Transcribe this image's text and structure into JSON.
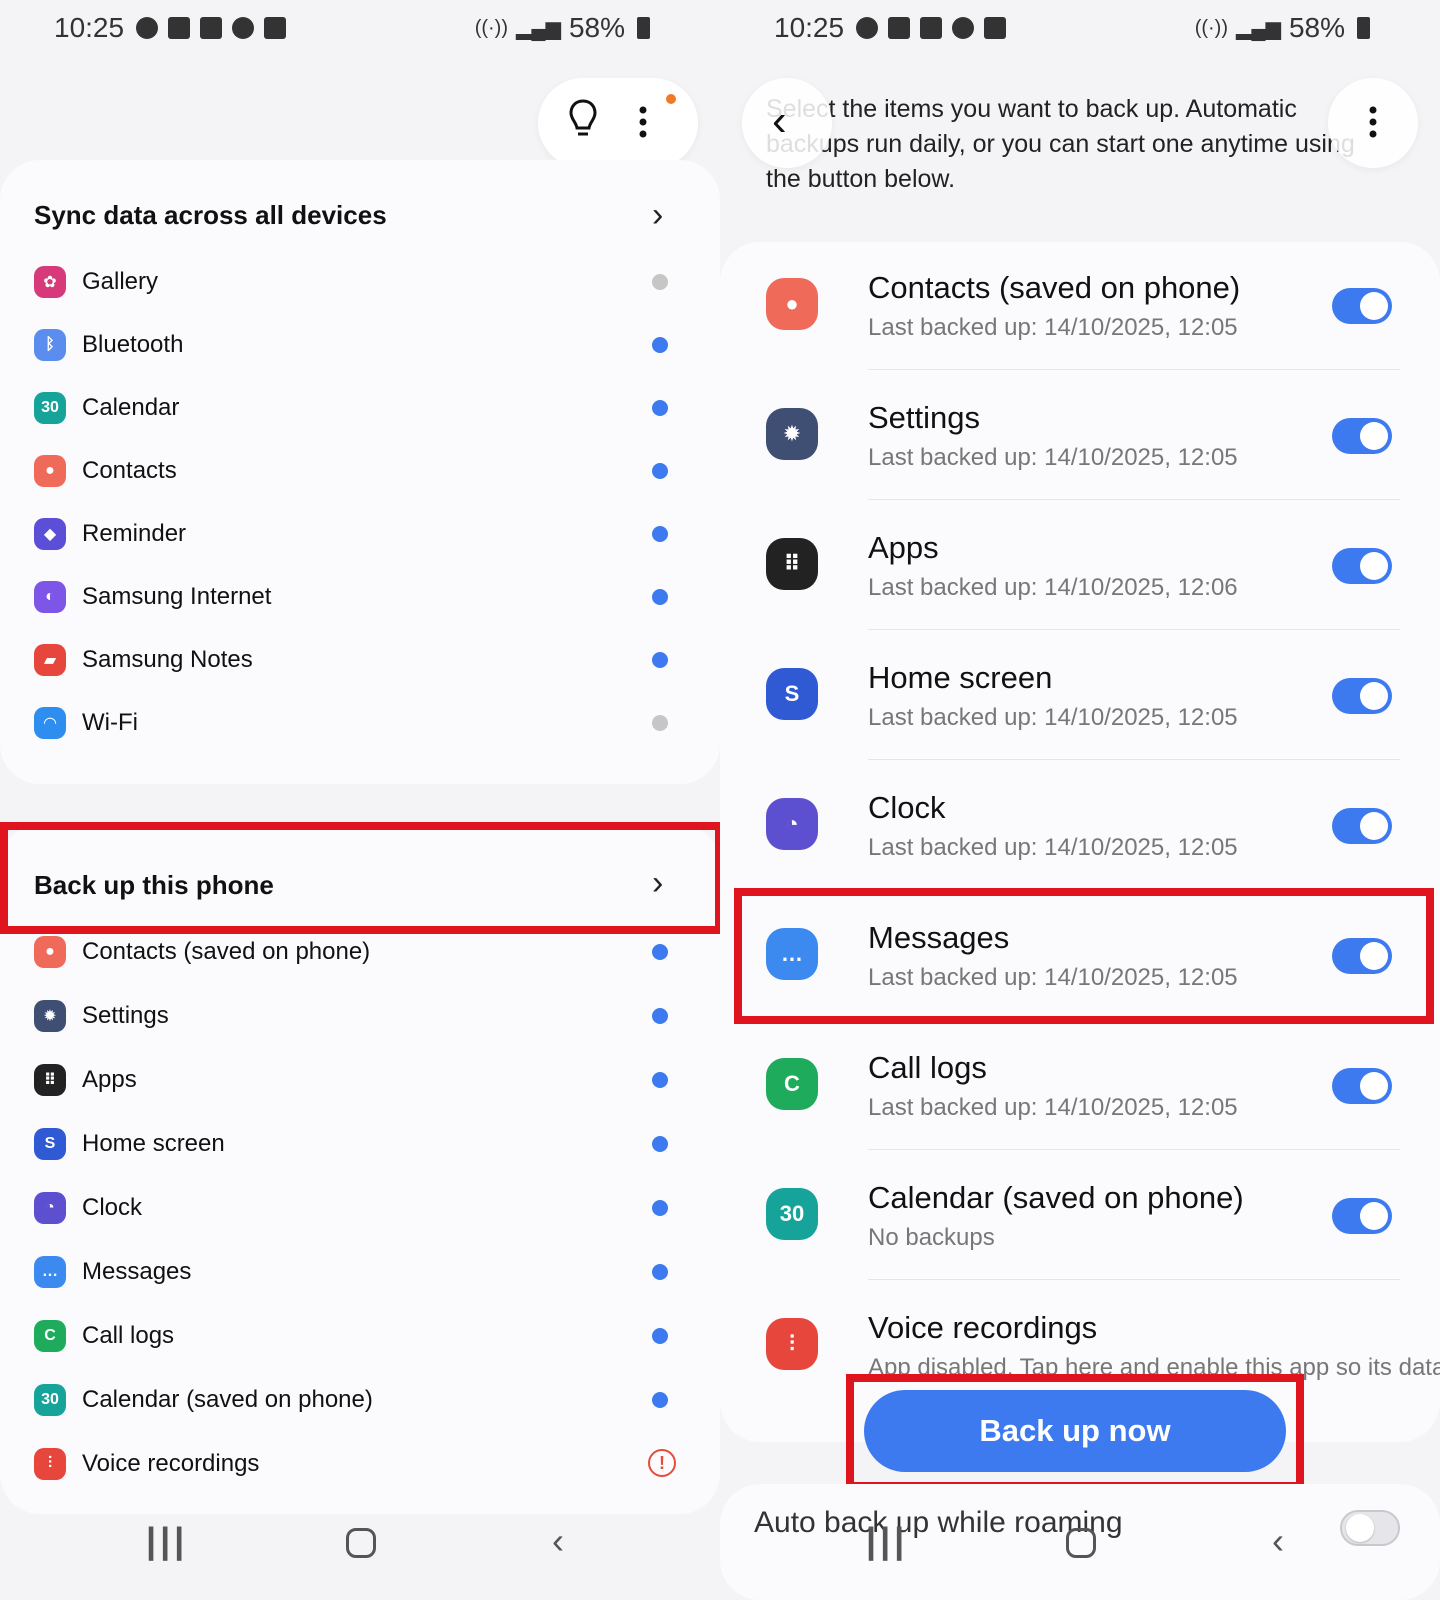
{
  "status_bar": {
    "time": "10:25",
    "battery": "58%"
  },
  "left": {
    "sync_title": "Sync data across all devices",
    "sync_items": [
      {
        "label": "Gallery",
        "icon": "gallery-icon",
        "color": "#d63a7a",
        "state": "off"
      },
      {
        "label": "Bluetooth",
        "icon": "bluetooth-icon",
        "color": "#5b8def",
        "state": "on"
      },
      {
        "label": "Calendar",
        "icon": "calendar-icon",
        "color": "#16a39a",
        "state": "on"
      },
      {
        "label": "Contacts",
        "icon": "contacts-icon",
        "color": "#f06a5a",
        "state": "on"
      },
      {
        "label": "Reminder",
        "icon": "reminder-icon",
        "color": "#5a4fd6",
        "state": "on"
      },
      {
        "label": "Samsung Internet",
        "icon": "internet-icon",
        "color": "#7d56e8",
        "state": "on"
      },
      {
        "label": "Samsung Notes",
        "icon": "notes-icon",
        "color": "#e6463b",
        "state": "on"
      },
      {
        "label": "Wi-Fi",
        "icon": "wifi-icon",
        "color": "#2d8ef0",
        "state": "off"
      }
    ],
    "backup_title": "Back up this phone",
    "backup_items": [
      {
        "label": "Contacts (saved on phone)",
        "icon": "contacts-icon",
        "color": "#f06a5a",
        "state": "on"
      },
      {
        "label": "Settings",
        "icon": "settings-icon",
        "color": "#3f4e73",
        "state": "on"
      },
      {
        "label": "Apps",
        "icon": "apps-icon",
        "color": "#222",
        "state": "on"
      },
      {
        "label": "Home screen",
        "icon": "home-screen-icon",
        "color": "#2f5ad3",
        "state": "on"
      },
      {
        "label": "Clock",
        "icon": "clock-icon",
        "color": "#5c4fd0",
        "state": "on"
      },
      {
        "label": "Messages",
        "icon": "messages-icon",
        "color": "#3c8af0",
        "state": "on"
      },
      {
        "label": "Call logs",
        "icon": "call-logs-icon",
        "color": "#1eab5b",
        "state": "on"
      },
      {
        "label": "Calendar (saved on phone)",
        "icon": "calendar-icon",
        "color": "#16a39a",
        "state": "on"
      },
      {
        "label": "Voice recordings",
        "icon": "voice-recordings-icon",
        "color": "#e6463b",
        "state": "warn"
      }
    ]
  },
  "right": {
    "intro_line1": "Select the items you want to back up. Automatic",
    "intro_line2": "backups run daily, or you can start one anytime using",
    "intro_line3": "the button below.",
    "items": [
      {
        "title": "Contacts (saved on phone)",
        "sub": "Last backed up: 14/10/2025, 12:05",
        "icon": "contacts-icon",
        "color": "#f06a5a",
        "on": true
      },
      {
        "title": "Settings",
        "sub": "Last backed up: 14/10/2025, 12:05",
        "icon": "settings-icon",
        "color": "#3f4e73",
        "on": true
      },
      {
        "title": "Apps",
        "sub": "Last backed up: 14/10/2025, 12:06",
        "icon": "apps-icon",
        "color": "#222",
        "on": true
      },
      {
        "title": "Home screen",
        "sub": "Last backed up: 14/10/2025, 12:05",
        "icon": "home-screen-icon",
        "color": "#2f5ad3",
        "on": true
      },
      {
        "title": "Clock",
        "sub": "Last backed up: 14/10/2025, 12:05",
        "icon": "clock-icon",
        "color": "#5c4fd0",
        "on": true
      },
      {
        "title": "Messages",
        "sub": "Last backed up: 14/10/2025, 12:05",
        "icon": "messages-icon",
        "color": "#3c8af0",
        "on": true
      },
      {
        "title": "Call logs",
        "sub": "Last backed up: 14/10/2025, 12:05",
        "icon": "call-logs-icon",
        "color": "#1eab5b",
        "on": true
      },
      {
        "title": "Calendar (saved on phone)",
        "sub": "No backups",
        "icon": "calendar-icon",
        "color": "#16a39a",
        "on": true
      }
    ],
    "voice_title": "Voice recordings",
    "voice_sub": "App disabled. Tap here and enable this app so its data",
    "backup_now": "Back up now",
    "auto_roaming": "Auto back up while roaming"
  },
  "accent_color": "#3d7af0",
  "highlight_color": "#e0141e"
}
